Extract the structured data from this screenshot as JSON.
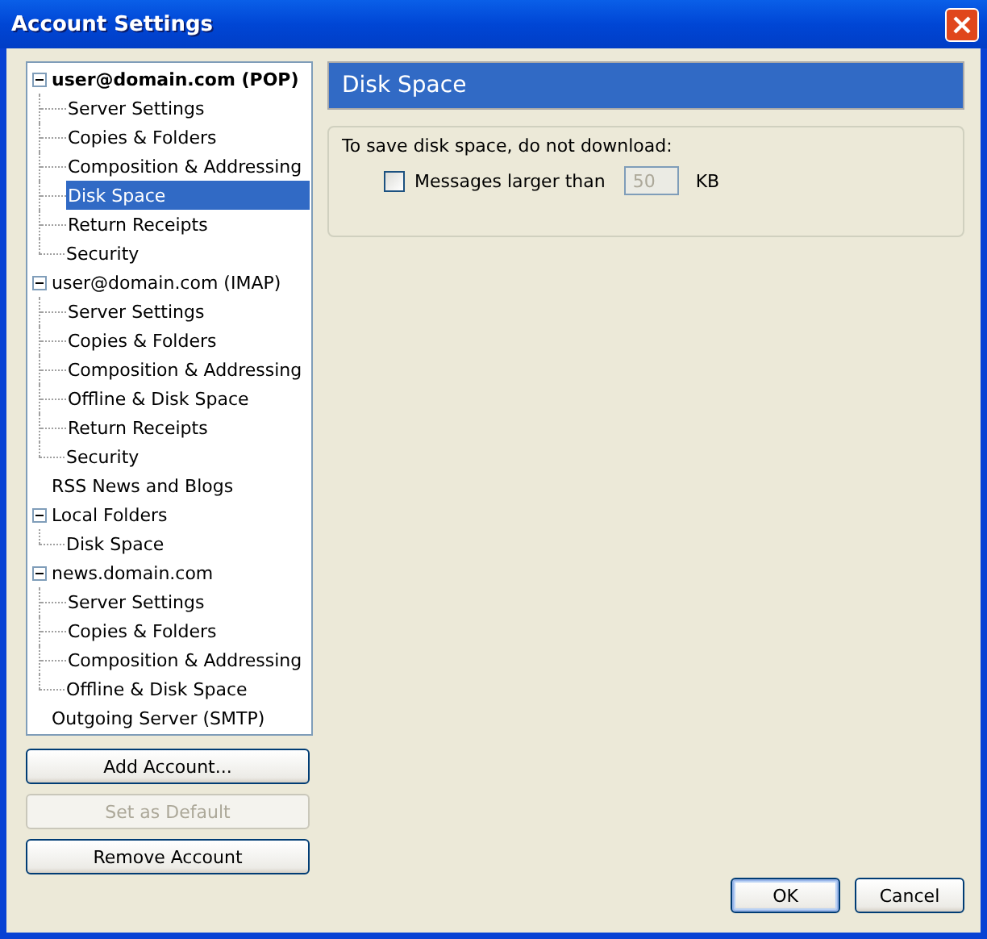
{
  "window": {
    "title": "Account Settings"
  },
  "tree": [
    {
      "label": "user@domain.com  (POP)",
      "default": true,
      "expanded": true,
      "selected": false,
      "children": [
        {
          "label": "Server Settings",
          "selected": false
        },
        {
          "label": "Copies & Folders",
          "selected": false
        },
        {
          "label": "Composition & Addressing",
          "selected": false
        },
        {
          "label": "Disk Space",
          "selected": true
        },
        {
          "label": "Return Receipts",
          "selected": false
        },
        {
          "label": "Security",
          "selected": false
        }
      ]
    },
    {
      "label": "user@domain.com  (IMAP)",
      "default": false,
      "expanded": true,
      "selected": false,
      "children": [
        {
          "label": "Server Settings",
          "selected": false
        },
        {
          "label": "Copies & Folders",
          "selected": false
        },
        {
          "label": "Composition & Addressing",
          "selected": false
        },
        {
          "label": "Offline & Disk Space",
          "selected": false
        },
        {
          "label": "Return Receipts",
          "selected": false
        },
        {
          "label": "Security",
          "selected": false
        }
      ]
    },
    {
      "label": "RSS News and Blogs",
      "default": false,
      "selected": false
    },
    {
      "label": "Local Folders",
      "default": false,
      "expanded": true,
      "selected": false,
      "children": [
        {
          "label": "Disk Space",
          "selected": false
        }
      ]
    },
    {
      "label": "news.domain.com",
      "default": false,
      "expanded": true,
      "selected": false,
      "children": [
        {
          "label": "Server Settings",
          "selected": false
        },
        {
          "label": "Copies & Folders",
          "selected": false
        },
        {
          "label": "Composition & Addressing",
          "selected": false
        },
        {
          "label": "Offline & Disk Space",
          "selected": false
        }
      ]
    },
    {
      "label": "Outgoing Server (SMTP)",
      "default": false,
      "selected": false
    }
  ],
  "account_buttons": [
    {
      "label": "Add Account...",
      "disabled": false
    },
    {
      "label": "Set as Default",
      "disabled": true
    },
    {
      "label": "Remove Account",
      "disabled": false
    }
  ],
  "panel": {
    "title": "Disk Space",
    "group_label": "To save disk space, do not download:",
    "option": {
      "label": "Messages larger than",
      "checked": false
    },
    "size_field": {
      "value": "50",
      "disabled": true
    },
    "unit": "KB"
  },
  "dialog_buttons": [
    "OK",
    "Cancel"
  ]
}
